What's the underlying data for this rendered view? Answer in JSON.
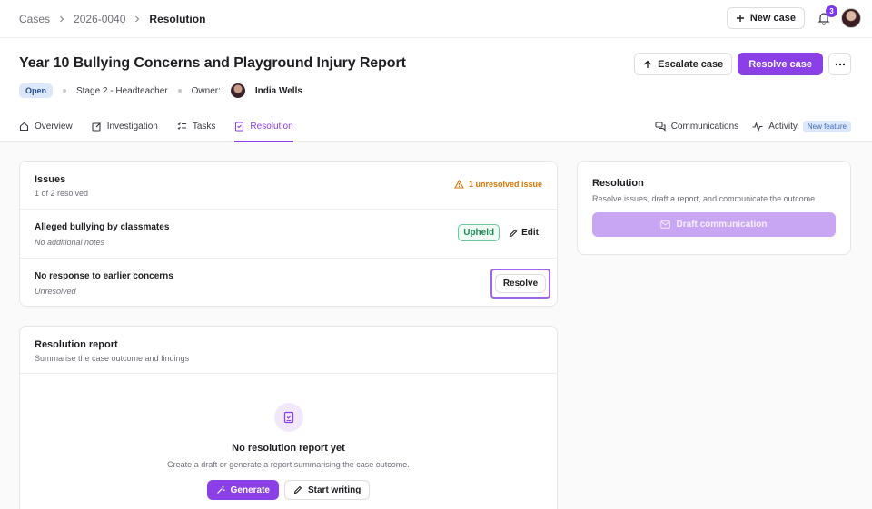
{
  "breadcrumbs": [
    "Cases",
    "2026-0040",
    "Resolution"
  ],
  "topbar": {
    "new_case_label": "New case",
    "notification_count": "3"
  },
  "header": {
    "title": "Year 10 Bullying Concerns and Playground Injury Report",
    "status": "Open",
    "stage": "Stage 2 - Headteacher",
    "owner_label": "Owner:",
    "owner_name": "India Wells",
    "escalate_label": "Escalate case",
    "resolve_case_label": "Resolve case"
  },
  "tabs": [
    {
      "label": "Overview",
      "icon": "home-icon"
    },
    {
      "label": "Investigation",
      "icon": "edit-square-icon"
    },
    {
      "label": "Tasks",
      "icon": "task-list-icon"
    },
    {
      "label": "Resolution",
      "icon": "report-icon",
      "active": true
    }
  ],
  "tabs_right": {
    "communications": "Communications",
    "activity": "Activity",
    "new_feature_badge": "New feature"
  },
  "issues": {
    "title": "Issues",
    "progress": "1 of 2 resolved",
    "warning": "1 unresolved issue",
    "items": [
      {
        "title": "Alleged bullying by classmates",
        "note": "No additional notes",
        "badge": "Upheld",
        "action": "Edit"
      },
      {
        "title": "No response to earlier concerns",
        "note": "Unresolved",
        "action": "Resolve"
      }
    ]
  },
  "resolution_report": {
    "title": "Resolution report",
    "subtitle": "Summarise the case outcome and findings",
    "empty_title": "No resolution report yet",
    "empty_subtitle": "Create a draft or generate a report summarising the case outcome.",
    "generate_label": "Generate",
    "start_writing_label": "Start writing"
  },
  "side_panel": {
    "title": "Resolution",
    "subtitle": "Resolve issues, draft a report, and communicate the outcome",
    "draft_label": "Draft communication"
  },
  "colors": {
    "accent": "#8b3fe6",
    "warning": "#d97706",
    "success": "#1e8a55"
  }
}
